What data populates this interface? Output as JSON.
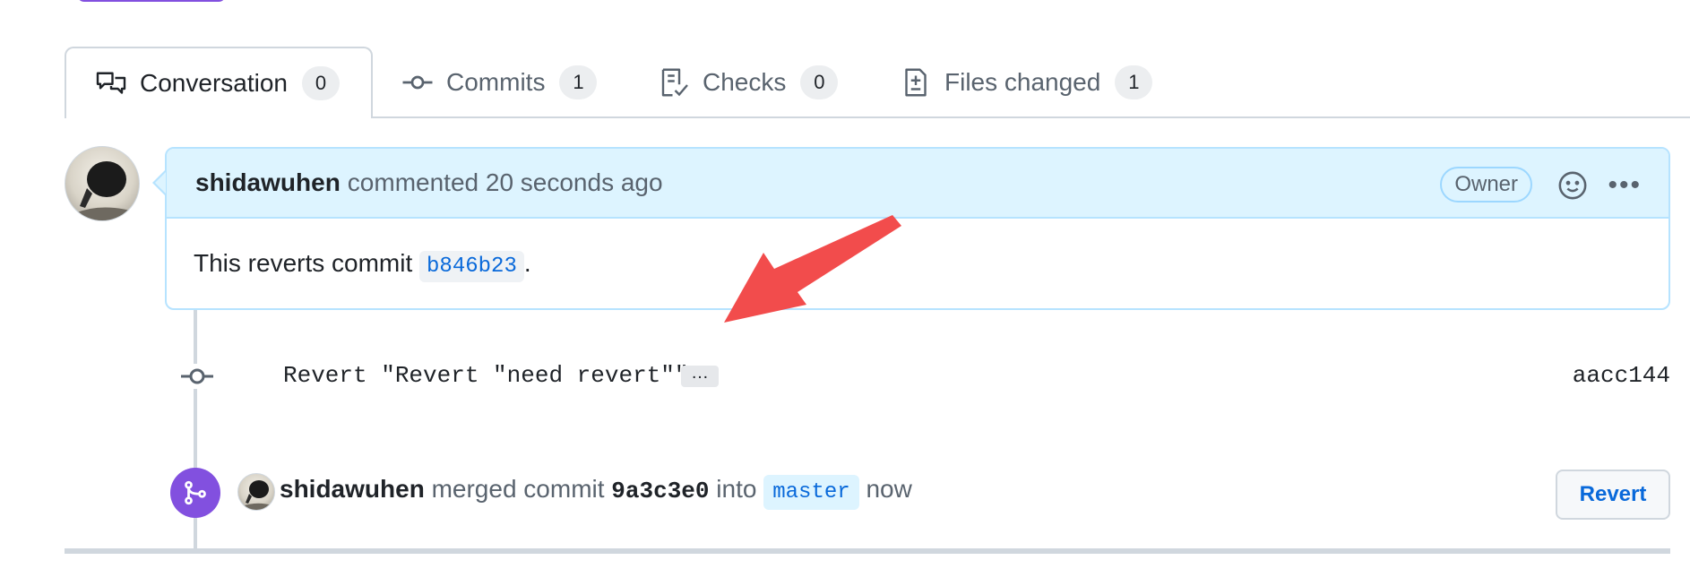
{
  "tabs": [
    {
      "label": "Conversation",
      "count": "0"
    },
    {
      "label": "Commits",
      "count": "1"
    },
    {
      "label": "Checks",
      "count": "0"
    },
    {
      "label": "Files changed",
      "count": "1"
    }
  ],
  "comment": {
    "author": "shidawuhen",
    "action": "commented 20 seconds ago",
    "badge": "Owner",
    "body_prefix": "This reverts commit ",
    "sha": "b846b23",
    "body_suffix": "."
  },
  "commit": {
    "message": "Revert \"Revert \"need revert\"\"",
    "ellipsis": "…",
    "sha": "aacc144"
  },
  "merge": {
    "author": "shidawuhen",
    "text1": "merged commit",
    "sha": "9a3c3e0",
    "text2": "into",
    "branch": "master",
    "time": "now",
    "revert_label": "Revert"
  },
  "colors": {
    "merge_purple": "#8250df",
    "link_blue": "#0969da",
    "header_blue": "#ddf4ff",
    "arrow_red": "#f24c4c"
  }
}
